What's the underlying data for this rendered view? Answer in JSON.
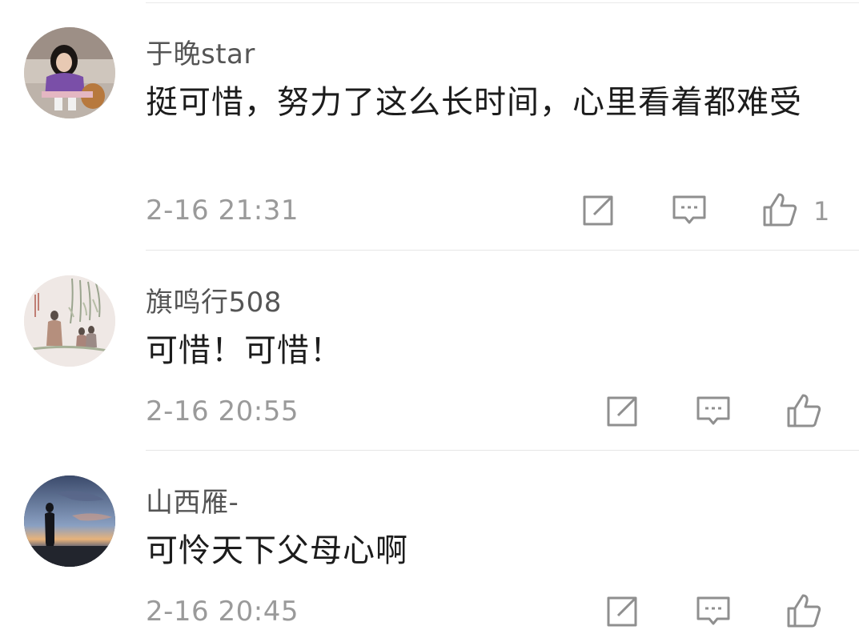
{
  "comments": [
    {
      "username": "于晚star",
      "text": "挺可惜，努力了这么长时间，心里看着都难受",
      "time": "2-16 21:31",
      "likes": "1",
      "avatar": "avatar-girl-photo"
    },
    {
      "username": "旗鸣行508",
      "text": "可惜！可惜！",
      "time": "2-16 20:55",
      "likes": "",
      "avatar": "avatar-ink-painting"
    },
    {
      "username": "山西雁-",
      "text": "可怜天下父母心啊",
      "time": "2-16 20:45",
      "likes": "",
      "avatar": "avatar-sunset-silhouette"
    }
  ],
  "icons": {
    "share": "share-icon",
    "reply": "comment-icon",
    "like": "thumbs-up-icon"
  },
  "colors": {
    "username": "#555555",
    "text": "#1c1c1c",
    "meta": "#9a9a9a",
    "divider": "#e6e6e6"
  }
}
